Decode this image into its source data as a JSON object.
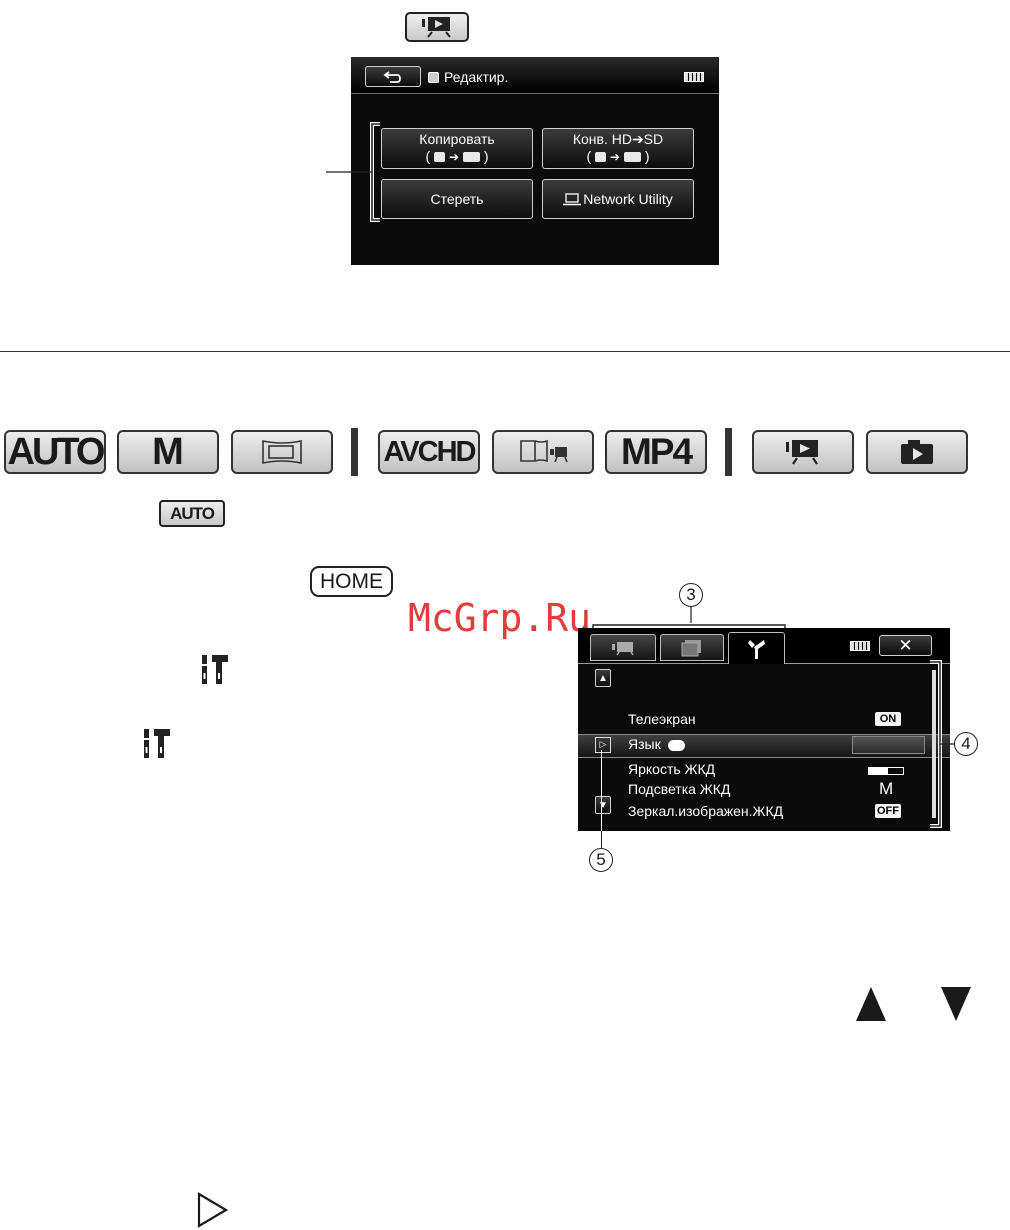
{
  "top_screen": {
    "title": "Редактир.",
    "buttons": {
      "copy_line1": "Копировать",
      "copy_line2": "(",
      "copy_line2_end": ")",
      "convert_line1": "Конв. HD➔SD",
      "convert_line2": "(",
      "convert_line2_end": ")",
      "delete": "Стереть",
      "network": "Network Utility"
    }
  },
  "mode_bar": {
    "auto": "AUTO",
    "manual": "M",
    "avchd": "AVCHD",
    "mp4": "MP4"
  },
  "keys": {
    "auto": "AUTO",
    "home": "HOME"
  },
  "watermark": "McGrp.Ru",
  "menu_screen": {
    "items": [
      "Телеэкран",
      "Язык",
      "Яркость ЖКД",
      "Подсветка ЖКД",
      "Зеркал.изображен.ЖКД"
    ],
    "values": {
      "tv": "ON",
      "backlight": "M",
      "mirror": "OFF"
    },
    "callouts": {
      "tabs": "3",
      "scrollbar": "4",
      "selector": "5"
    }
  },
  "icons": [
    "playback-icon",
    "photo-icon",
    "wrench-icon",
    "tools-icon",
    "arrow-up-icon",
    "arrow-down-icon",
    "triangle-right-icon",
    "battery-icon",
    "close-icon",
    "back-icon",
    "memory-icon",
    "sd-card-icon",
    "computer-icon"
  ]
}
